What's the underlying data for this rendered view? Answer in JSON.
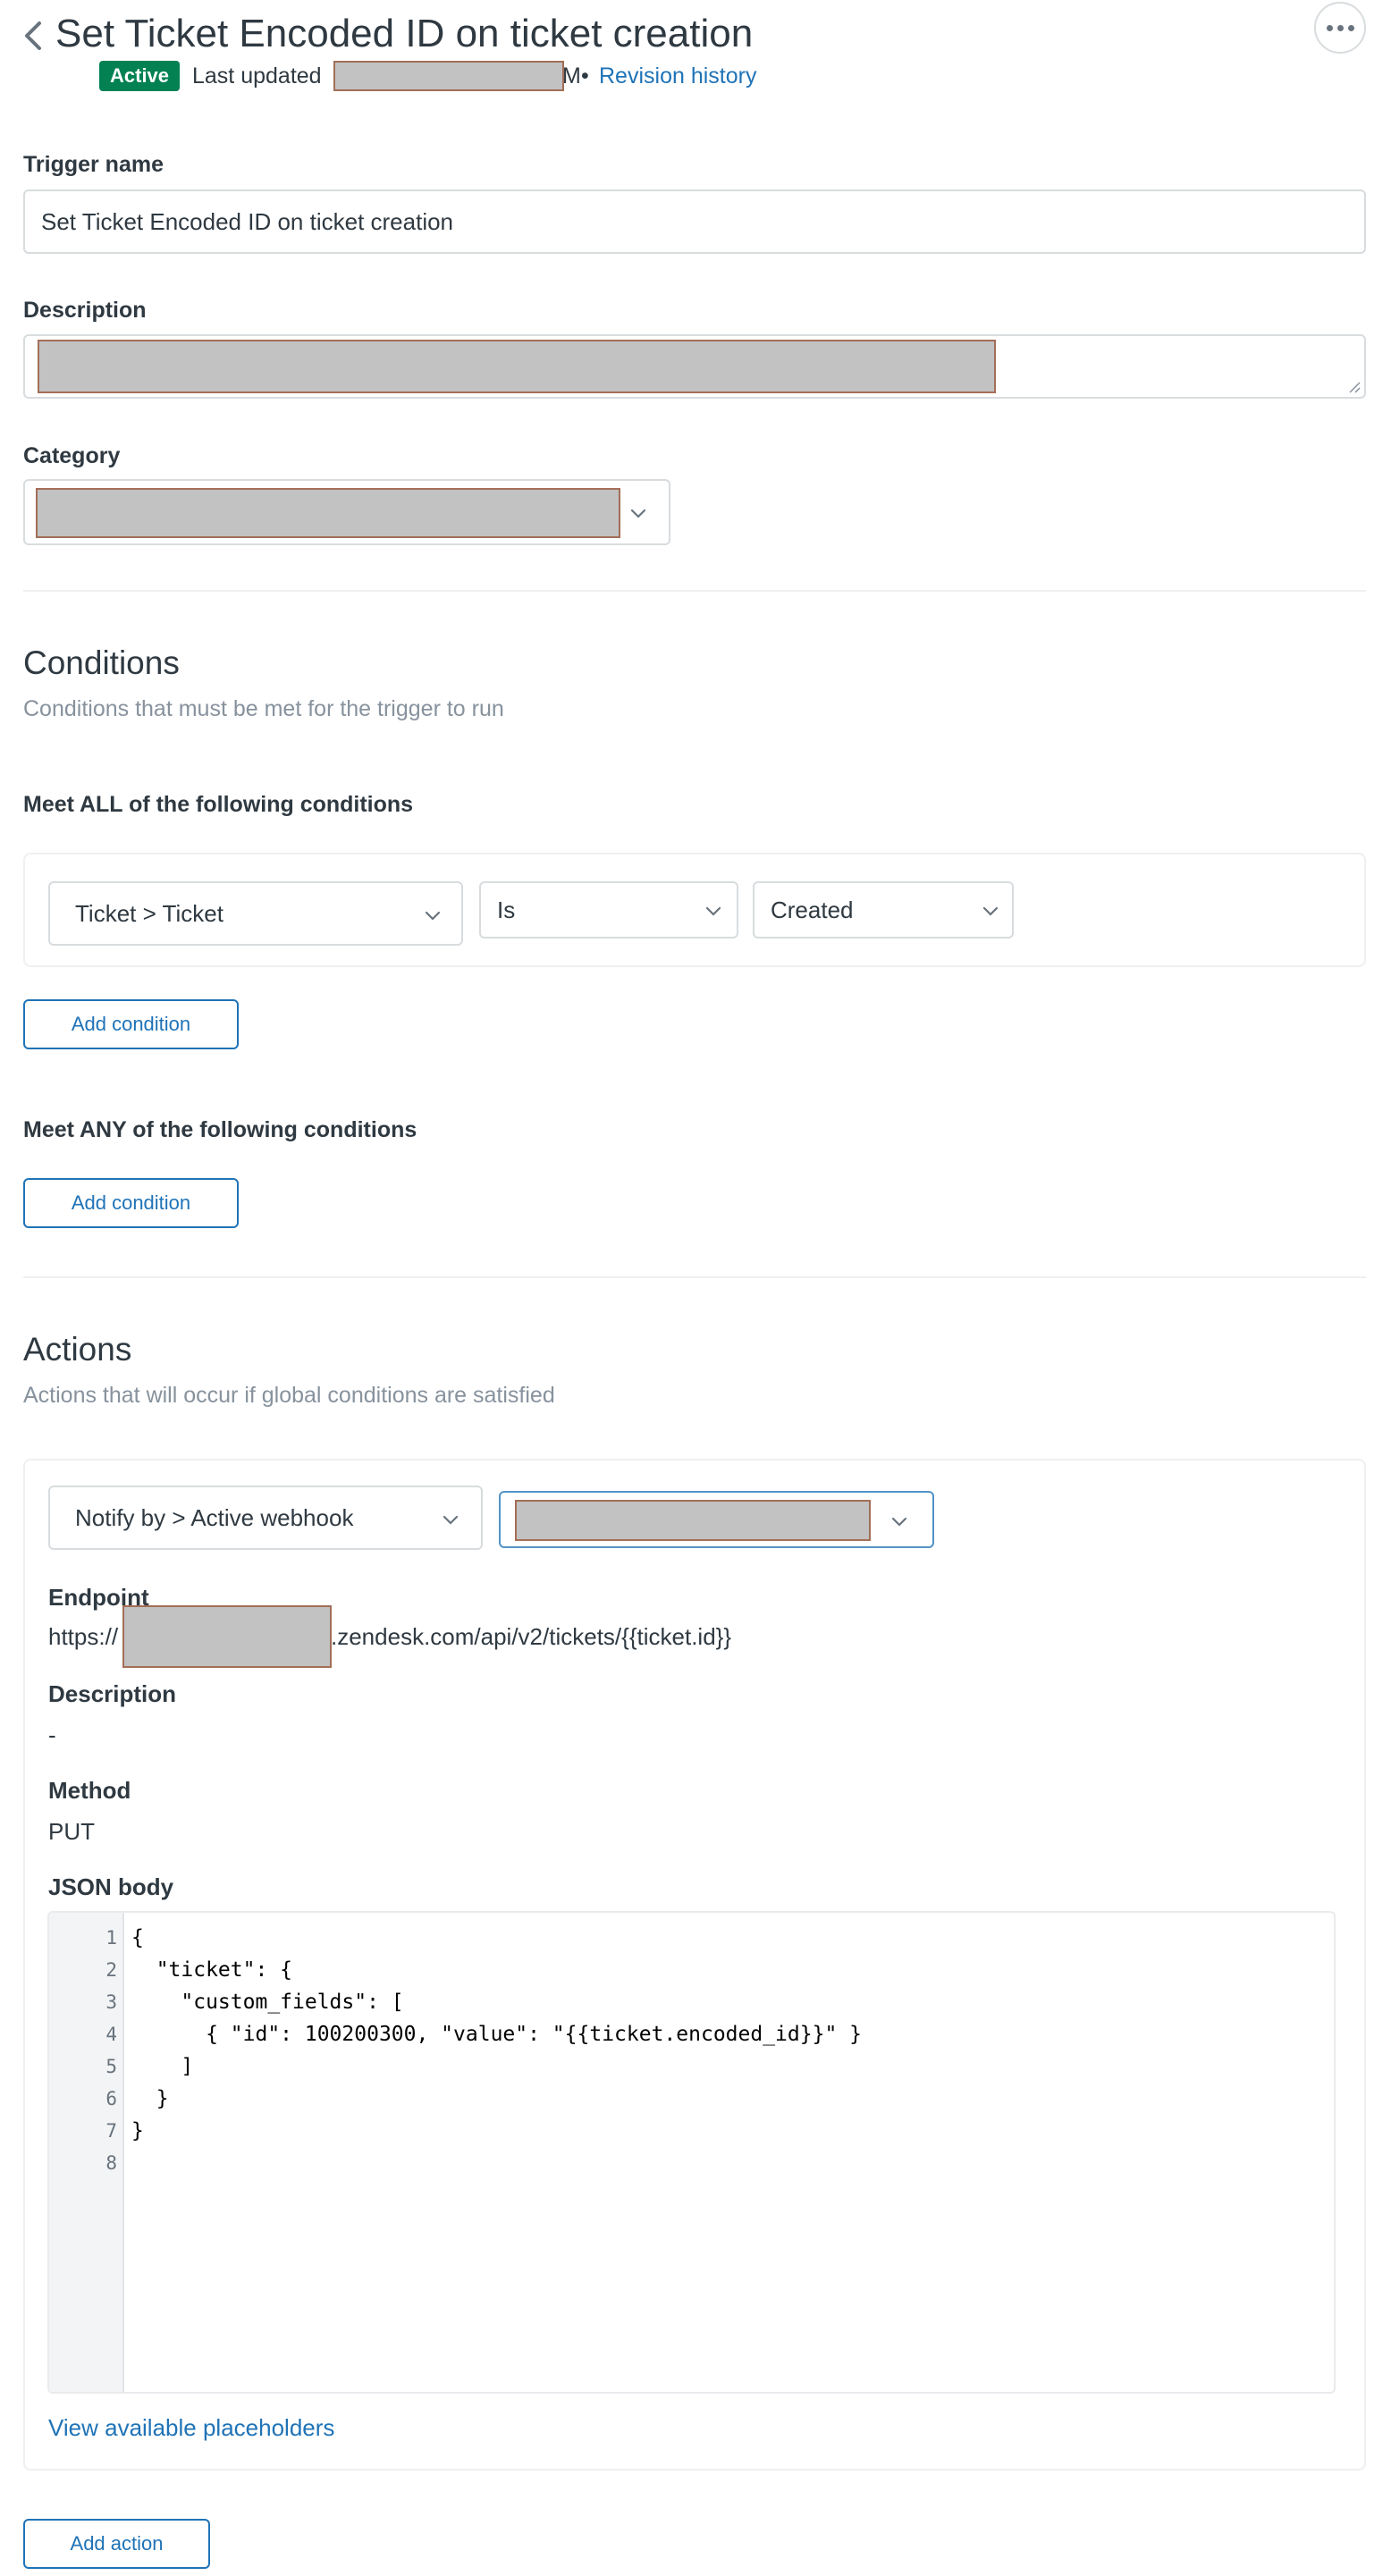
{
  "header": {
    "title": "Set Ticket Encoded ID on ticket creation",
    "status": "Active",
    "last_updated_label": "Last updated",
    "last_updated_suffix": "M",
    "separator": "•",
    "revision_link": "Revision history",
    "back_icon": "chevron-left-icon",
    "more_icon": "overflow-menu-icon"
  },
  "form": {
    "trigger_name_label": "Trigger name",
    "trigger_name_value": "Set Ticket Encoded ID on ticket creation",
    "description_label": "Description",
    "category_label": "Category"
  },
  "conditions": {
    "title": "Conditions",
    "subtitle": "Conditions that must be met for the trigger to run",
    "all_heading": "Meet ALL of the following conditions",
    "all_rows": [
      {
        "field": "Ticket > Ticket",
        "operator": "Is",
        "value": "Created"
      }
    ],
    "any_heading": "Meet ANY of the following conditions",
    "add_condition_label": "Add condition"
  },
  "actions": {
    "title": "Actions",
    "subtitle": "Actions that will occur if global conditions are satisfied",
    "action_type": "Notify by > Active webhook",
    "endpoint_label": "Endpoint",
    "endpoint_prefix": "https://",
    "endpoint_suffix": ".zendesk.com/api/v2/tickets/{{ticket.id}}",
    "description_label": "Description",
    "description_value": "-",
    "method_label": "Method",
    "method_value": "PUT",
    "json_body_label": "JSON body",
    "json_lines": [
      "{",
      "  \"ticket\": {",
      "    \"custom_fields\": [",
      "      { \"id\": 100200300, \"value\": \"{{ticket.encoded_id}}\" }",
      "    ]",
      "  }",
      "}",
      ""
    ],
    "line_numbers": [
      "1",
      "2",
      "3",
      "4",
      "5",
      "6",
      "7",
      "8"
    ],
    "placeholders_link": "View available placeholders",
    "add_action_label": "Add action"
  },
  "colors": {
    "accent": "#1f73b7",
    "active_badge": "#038153",
    "redaction": "#c2c2c2"
  }
}
